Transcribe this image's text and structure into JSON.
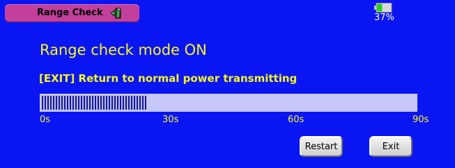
{
  "header": {
    "title": "Range Check",
    "title_icon": "exit-door-icon"
  },
  "status": {
    "battery_percent_label": "37%",
    "battery_level": 0.37,
    "battery_icon": "battery-icon"
  },
  "main": {
    "mode_title": "Range check mode ON",
    "exit_hint": "[EXIT] Return to normal power transmitting",
    "progress": {
      "fraction": 0.28,
      "ticks": [
        "0s",
        "30s",
        "60s",
        "90s"
      ]
    },
    "buttons": {
      "restart": "Restart",
      "exit": "Exit"
    }
  },
  "colors": {
    "background": "#0a16f2",
    "accent_text": "#f6f620",
    "title_tab": "#c2409c",
    "progress_track": "#c6c8fa",
    "progress_fill": "#181890"
  }
}
